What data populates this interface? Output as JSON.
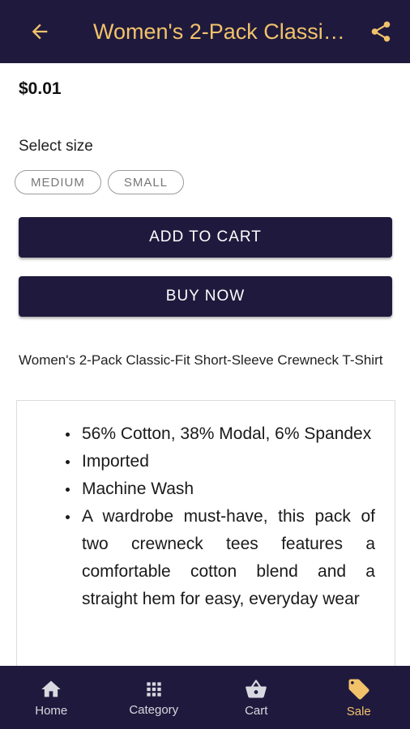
{
  "appbar": {
    "title": "Women's 2-Pack Classic-Fit Short-Sleeve Crewneck T-Shirt",
    "back_icon": "arrow-back-icon",
    "share_icon": "share-icon"
  },
  "product": {
    "price": "$0.01",
    "size_label": "Select size",
    "sizes": [
      "MEDIUM",
      "SMALL"
    ],
    "name": "Women's 2-Pack Classic-Fit Short-Sleeve Crewneck T-Shirt",
    "add_to_cart": "ADD TO CART",
    "buy_now": "BUY NOW",
    "description": [
      "56% Cotton, 38% Modal, 6% Spandex",
      "Imported",
      "Machine Wash",
      "A wardrobe must-have, this pack of two crewneck tees features a comfortable cotton blend and a straight hem for easy, everyday wear"
    ]
  },
  "bottom_nav": {
    "items": [
      {
        "label": "Home",
        "icon": "home-icon"
      },
      {
        "label": "Category",
        "icon": "grid-icon"
      },
      {
        "label": "Cart",
        "icon": "basket-icon"
      },
      {
        "label": "Sale",
        "icon": "tag-icon",
        "active": true
      }
    ]
  },
  "colors": {
    "primary": "#1f1a3d",
    "accent": "#f2c26b"
  }
}
